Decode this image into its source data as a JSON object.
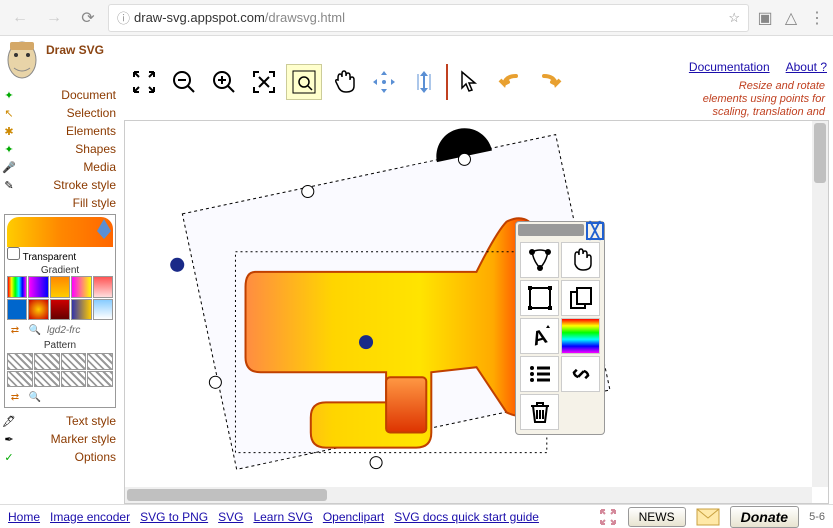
{
  "browser": {
    "url_host": "draw-svg.appspot.com",
    "url_path": "/drawsvg.html"
  },
  "app": {
    "title": "Draw SVG",
    "doc_link": "Documentation",
    "about_link": "About ?",
    "hint_line1": "Resize and rotate",
    "hint_line2": "elements using points for",
    "hint_line3": "scaling, translation and"
  },
  "menu": [
    {
      "label": "Document"
    },
    {
      "label": "Selection"
    },
    {
      "label": "Elements"
    },
    {
      "label": "Shapes"
    },
    {
      "label": "Media"
    },
    {
      "label": "Stroke style"
    },
    {
      "label": "Fill style"
    }
  ],
  "menu2": [
    {
      "label": "Text style"
    },
    {
      "label": "Marker style"
    },
    {
      "label": "Options"
    }
  ],
  "fill": {
    "transparent": "Transparent",
    "gradient": "Gradient",
    "pattern": "Pattern",
    "code": "lgd2-frc"
  },
  "footer": {
    "links": [
      "Home",
      "Image encoder",
      "SVG to PNG",
      "SVG",
      "Learn SVG",
      "Openclipart",
      "SVG docs quick start guide"
    ],
    "news": "NEWS",
    "donate": "Donate",
    "page": "5-6"
  }
}
